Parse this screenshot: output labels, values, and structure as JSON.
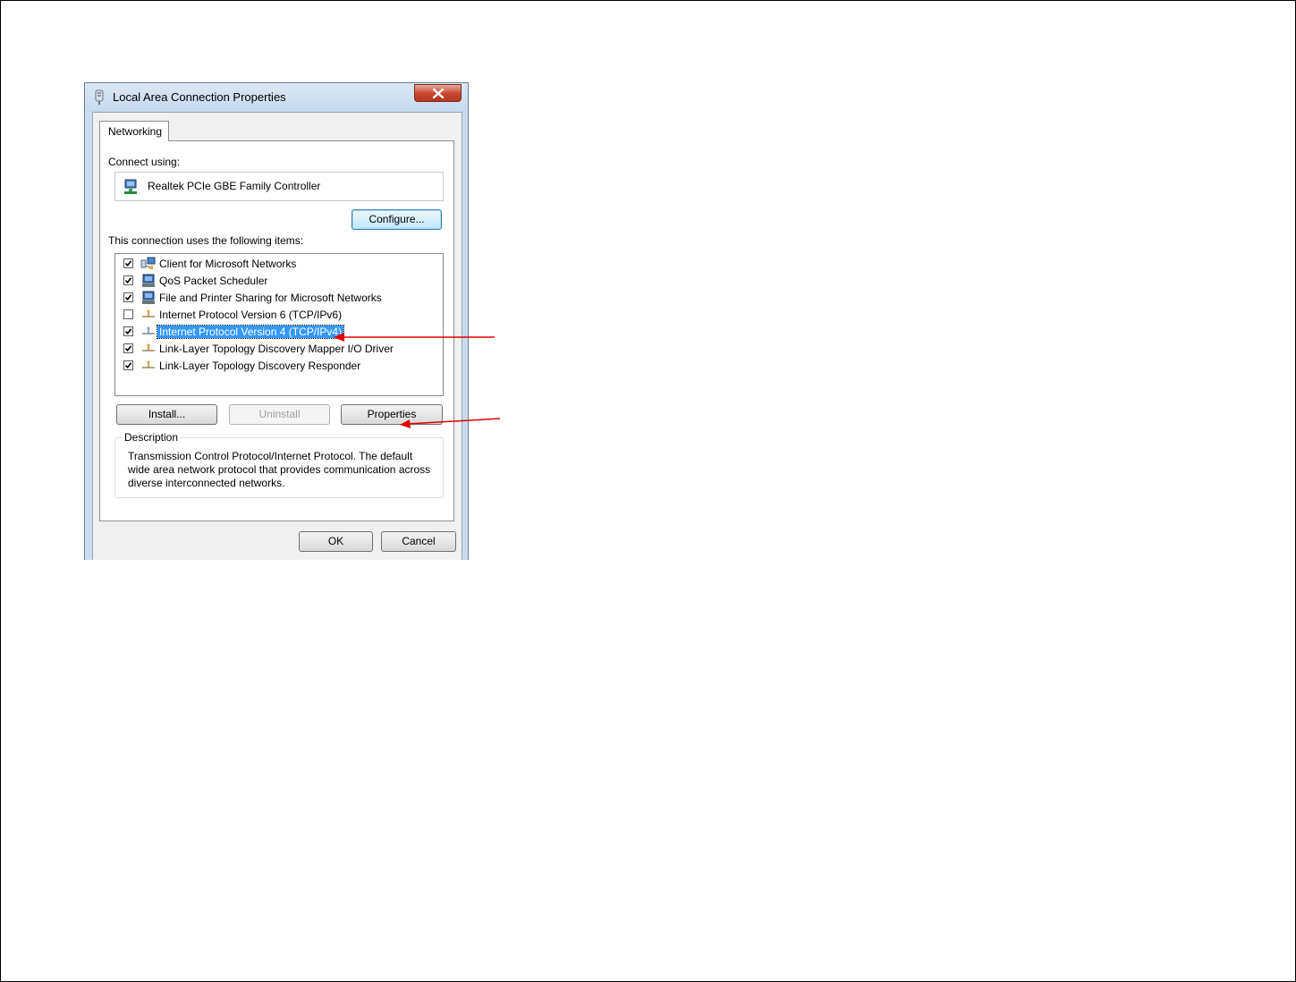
{
  "window": {
    "title": "Local Area Connection Properties"
  },
  "tabs": [
    {
      "label": "Networking",
      "selected": true
    }
  ],
  "networking": {
    "connect_using_label": "Connect using:",
    "adapter_name": "Realtek PCIe GBE Family Controller",
    "configure_button": "Configure...",
    "items_label": "This connection uses the following items:",
    "items": [
      {
        "label": "Client for Microsoft Networks",
        "checked": true,
        "icon": "client-network-icon"
      },
      {
        "label": "QoS Packet Scheduler",
        "checked": true,
        "icon": "computer-network-icon"
      },
      {
        "label": "File and Printer Sharing for Microsoft Networks",
        "checked": true,
        "icon": "computer-network-icon"
      },
      {
        "label": "Internet Protocol Version 6 (TCP/IPv6)",
        "checked": false,
        "icon": "protocol-icon"
      },
      {
        "label": "Internet Protocol Version 4 (TCP/IPv4)",
        "checked": true,
        "icon": "protocol-icon",
        "selected": true
      },
      {
        "label": "Link-Layer Topology Discovery Mapper I/O Driver",
        "checked": true,
        "icon": "protocol-icon"
      },
      {
        "label": "Link-Layer Topology Discovery Responder",
        "checked": true,
        "icon": "protocol-icon"
      }
    ],
    "install_button": "Install...",
    "uninstall_button": "Uninstall",
    "properties_button": "Properties",
    "description_title": "Description",
    "description_text": "Transmission Control Protocol/Internet Protocol. The default wide area network protocol that provides communication across diverse interconnected networks."
  },
  "footer": {
    "ok_button": "OK",
    "cancel_button": "Cancel"
  },
  "colors": {
    "selection": "#3399ff",
    "annotation_arrow": "#e00000",
    "close_button": "#c9442c"
  }
}
